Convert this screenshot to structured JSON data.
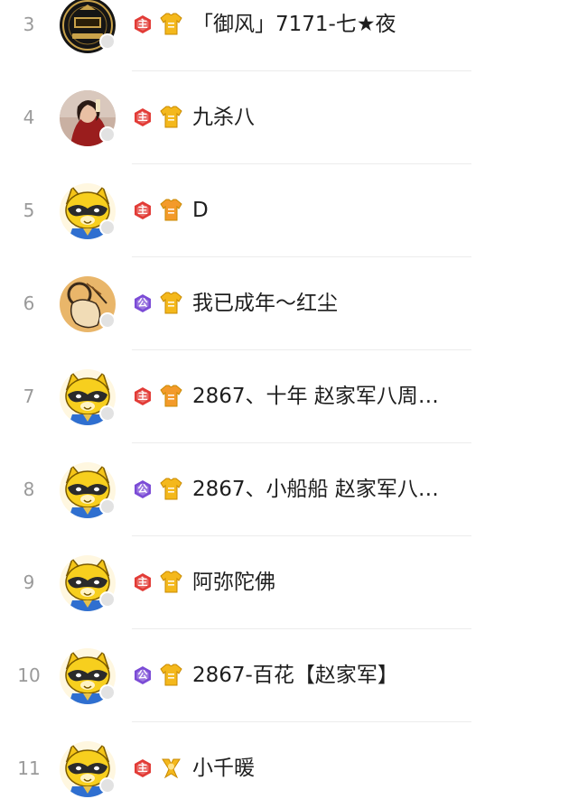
{
  "rows": [
    {
      "rank": "3",
      "nickname": "「御风」7171-七★夜",
      "role_label": "主",
      "role_icon": "red-role-badge-icon",
      "vest_icon": "gold-vest-icon",
      "avatar_icon": "boss-logo-avatar"
    },
    {
      "rank": "4",
      "nickname": "九杀八",
      "role_label": "主",
      "role_icon": "red-role-badge-icon",
      "vest_icon": "gold-vest-icon",
      "avatar_icon": "photo-avatar"
    },
    {
      "rank": "5",
      "nickname": "D",
      "role_label": "主",
      "role_icon": "red-role-badge-icon",
      "vest_icon": "orange-vest-icon",
      "avatar_icon": "raccoon-avatar"
    },
    {
      "rank": "6",
      "nickname": "我已成年～红尘",
      "role_label": "公",
      "role_icon": "purple-role-badge-icon",
      "vest_icon": "gold-vest-icon",
      "avatar_icon": "drawing-avatar"
    },
    {
      "rank": "7",
      "nickname": "2867、十年 赵家军八周…",
      "role_label": "主",
      "role_icon": "red-role-badge-icon",
      "vest_icon": "orange-vest-icon",
      "avatar_icon": "raccoon-avatar"
    },
    {
      "rank": "8",
      "nickname": "2867、小船船 赵家军八…",
      "role_label": "公",
      "role_icon": "purple-role-badge-icon",
      "vest_icon": "gold-vest-icon",
      "avatar_icon": "raccoon-avatar"
    },
    {
      "rank": "9",
      "nickname": "阿弥陀佛",
      "role_label": "主",
      "role_icon": "red-role-badge-icon",
      "vest_icon": "gold-vest-icon",
      "avatar_icon": "raccoon-avatar"
    },
    {
      "rank": "10",
      "nickname": "2867-百花【赵家军】",
      "role_label": "公",
      "role_icon": "purple-role-badge-icon",
      "vest_icon": "gold-vest-icon",
      "avatar_icon": "raccoon-avatar"
    },
    {
      "rank": "11",
      "nickname": "小千暖",
      "role_label": "主",
      "role_icon": "red-role-badge-icon",
      "vest_icon": "gold-ribbon-icon",
      "avatar_icon": "raccoon-avatar"
    }
  ],
  "colors": {
    "rank_text": "#9a9a9a",
    "nickname_text": "#1e1e1e",
    "role_red": "#e23b36",
    "role_purple": "#7b4bd6",
    "vest_gold": "#f4b81c",
    "vest_orange": "#f39a2a",
    "divider": "#ececec"
  }
}
